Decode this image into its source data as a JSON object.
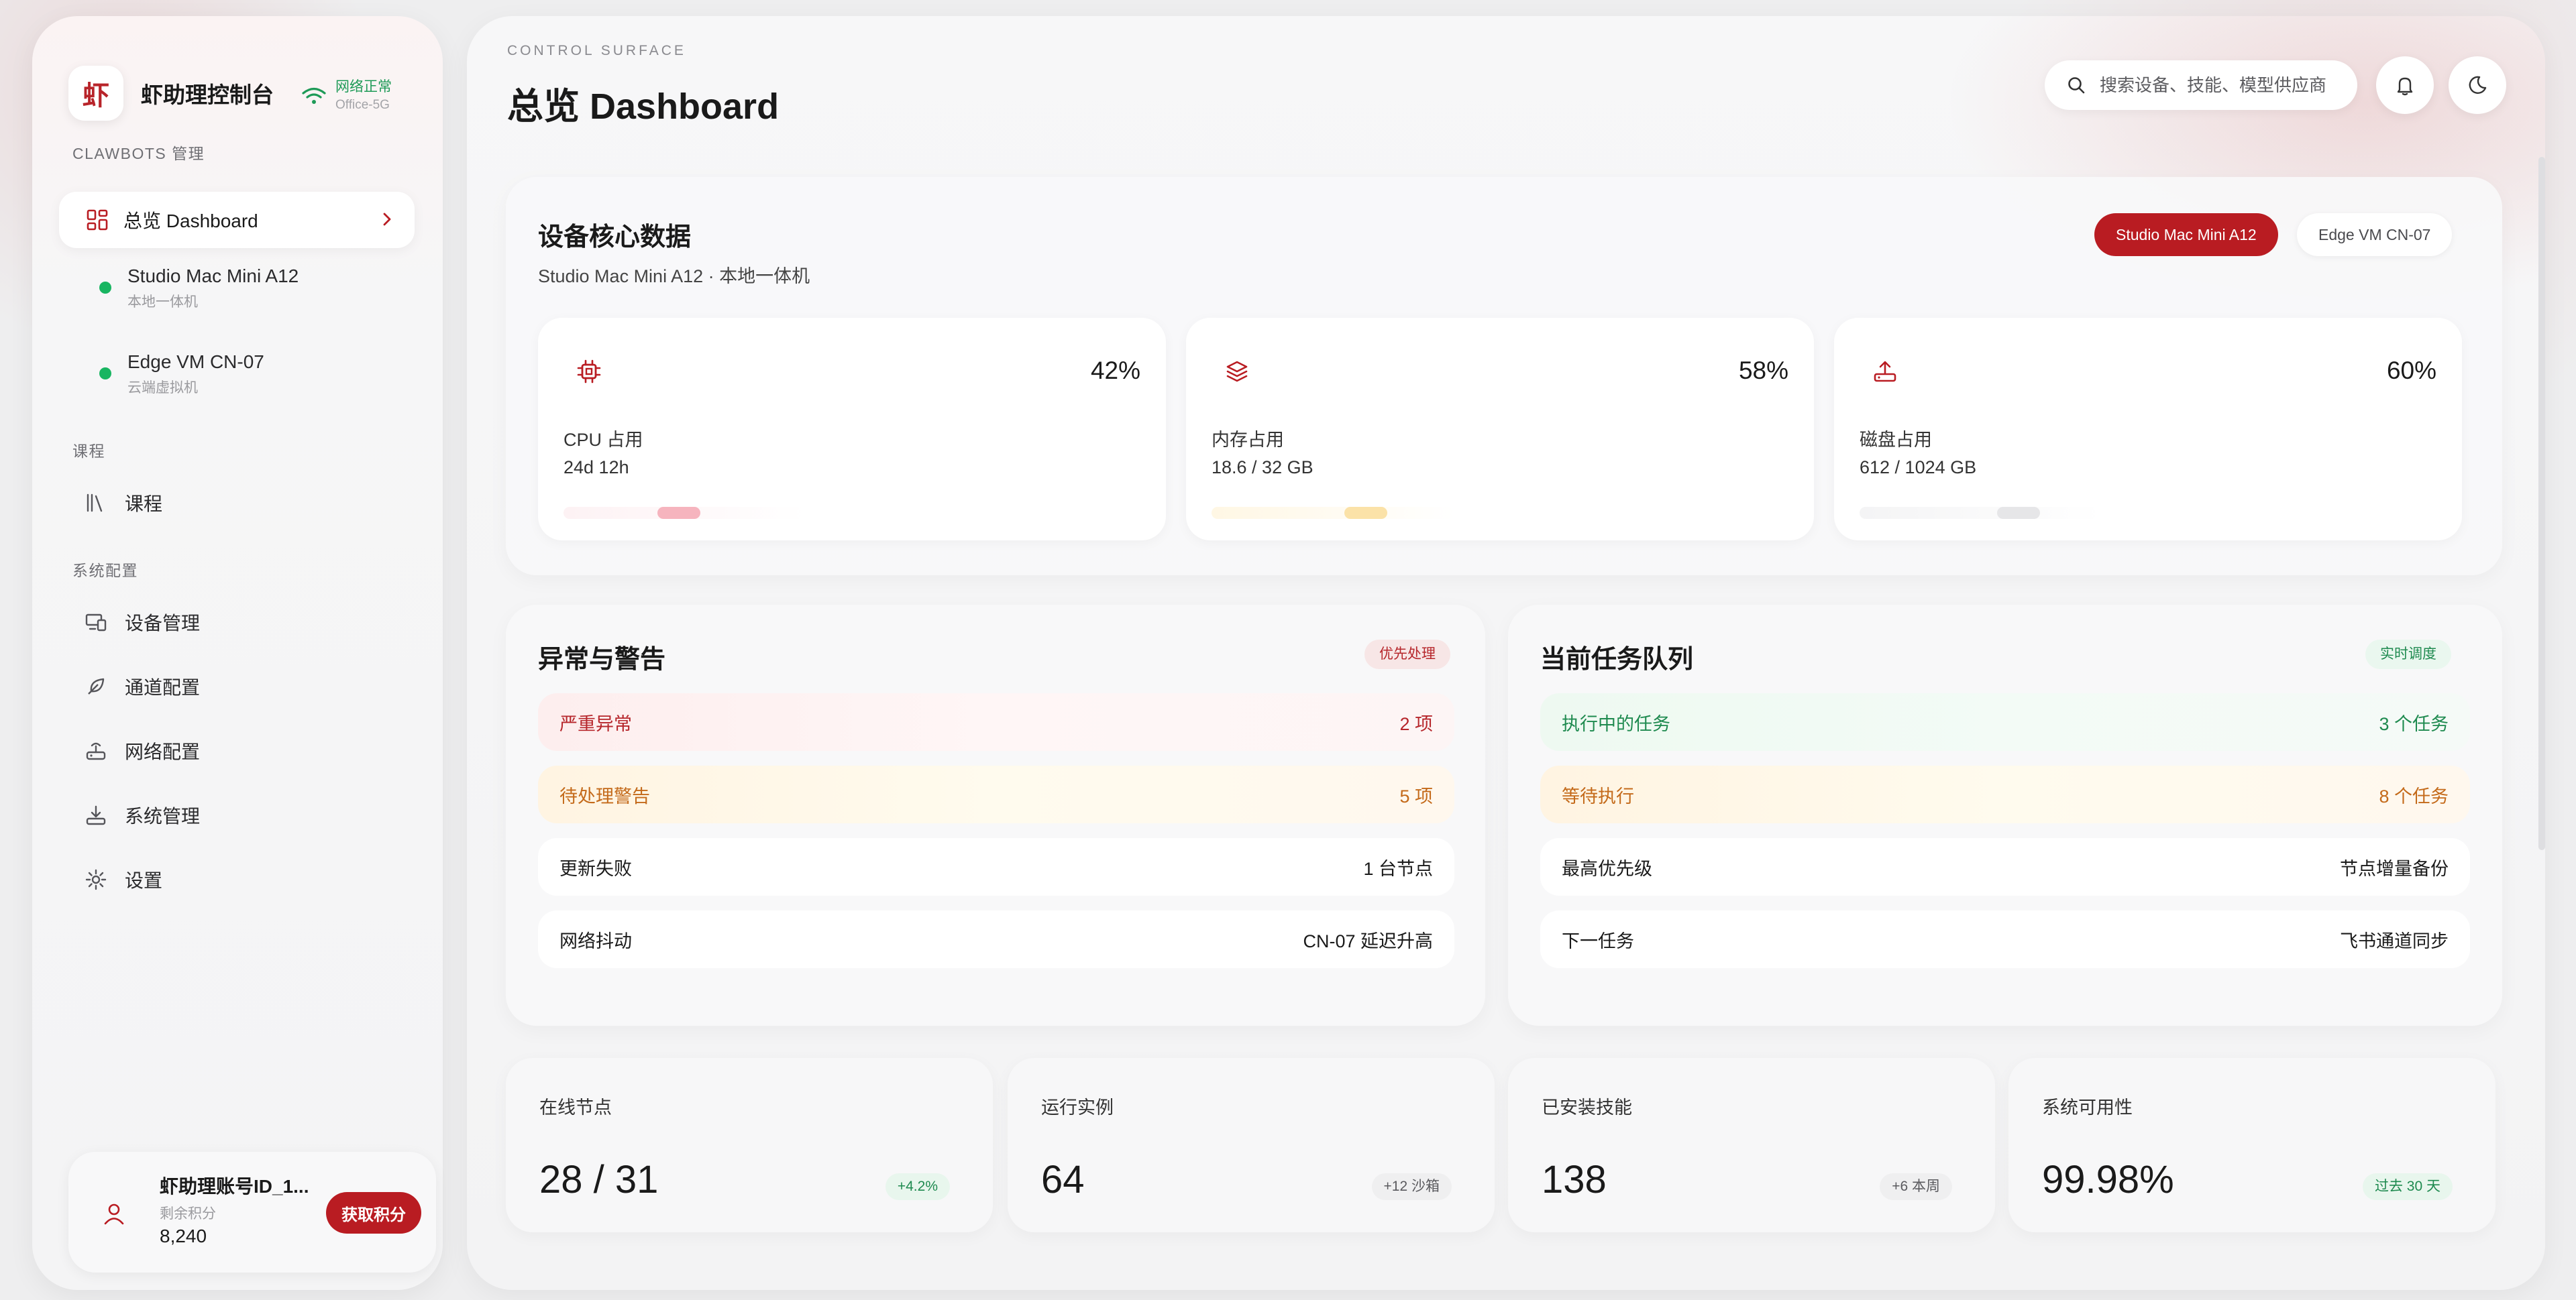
{
  "app": {
    "brand_logo": "虾",
    "brand_name": "虾助理控制台",
    "network_status": "网络正常",
    "network_ssid": "Office-5G"
  },
  "sidebar": {
    "section_clawbots": "CLAWBOTS 管理",
    "active_item": "总览 Dashboard",
    "devices": [
      {
        "name": "Studio Mac Mini A12",
        "sub": "本地一体机",
        "status_color": "#18b561"
      },
      {
        "name": "Edge VM CN-07",
        "sub": "云端虚拟机",
        "status_color": "#18b561"
      }
    ],
    "section_course": "课程",
    "course_item": "课程",
    "section_system": "系统配置",
    "system_items": [
      "设备管理",
      "通道配置",
      "网络配置",
      "系统管理",
      "设置"
    ]
  },
  "account": {
    "name": "虾助理账号ID_1...",
    "points_label": "剩余积分",
    "points": "8,240",
    "get_points_label": "获取积分"
  },
  "header": {
    "overline": "CONTROL SURFACE",
    "title": "总览 Dashboard",
    "search_placeholder": "搜索设备、技能、模型供应商"
  },
  "core": {
    "title": "设备核心数据",
    "subtitle": "Studio Mac Mini A12 · 本地一体机",
    "device_tabs": [
      "Studio Mac Mini A12",
      "Edge VM CN-07"
    ],
    "selected_tab": "Studio Mac Mini A12",
    "metrics": [
      {
        "icon": "cpu-icon",
        "percent": "42%",
        "label": "CPU 占用",
        "value": "24d 12h",
        "level": 0.42,
        "color": "#f6b4be"
      },
      {
        "icon": "layers-icon",
        "percent": "58%",
        "label": "内存占用",
        "value": "18.6 / 32 GB",
        "level": 0.58,
        "color": "#fbe2a8"
      },
      {
        "icon": "upload-icon",
        "percent": "60%",
        "label": "磁盘占用",
        "value": "612 / 1024 GB",
        "level": 0.6,
        "color": "#e6e6e8"
      }
    ]
  },
  "alerts": {
    "title": "异常与警告",
    "tag": "优先处理",
    "rows": [
      {
        "label": "严重异常",
        "value": "2 项",
        "tone": "red"
      },
      {
        "label": "待处理警告",
        "value": "5 项",
        "tone": "amber"
      },
      {
        "label": "更新失败",
        "value": "1 台节点",
        "tone": "plain"
      },
      {
        "label": "网络抖动",
        "value": "CN-07 延迟升高",
        "tone": "plain"
      }
    ]
  },
  "queue": {
    "title": "当前任务队列",
    "tag": "实时调度",
    "rows": [
      {
        "label": "执行中的任务",
        "value": "3 个任务",
        "tone": "green"
      },
      {
        "label": "等待执行",
        "value": "8 个任务",
        "tone": "amber"
      },
      {
        "label": "最高优先级",
        "value": "节点增量备份",
        "tone": "plain"
      },
      {
        "label": "下一任务",
        "value": "飞书通道同步",
        "tone": "plain"
      }
    ]
  },
  "stats": [
    {
      "label": "在线节点",
      "value": "28 / 31",
      "badge": "+4.2%",
      "badge_tone": "green"
    },
    {
      "label": "运行实例",
      "value": "64",
      "badge": "+12 沙箱",
      "badge_tone": "gray"
    },
    {
      "label": "已安装技能",
      "value": "138",
      "badge": "+6 本周",
      "badge_tone": "gray"
    },
    {
      "label": "系统可用性",
      "value": "99.98%",
      "badge": "过去 30 天",
      "badge_tone": "green"
    }
  ],
  "colors": {
    "accent": "#b91c22",
    "success": "#1e9a57",
    "warning": "#c46a1a",
    "danger": "#b6262b"
  }
}
